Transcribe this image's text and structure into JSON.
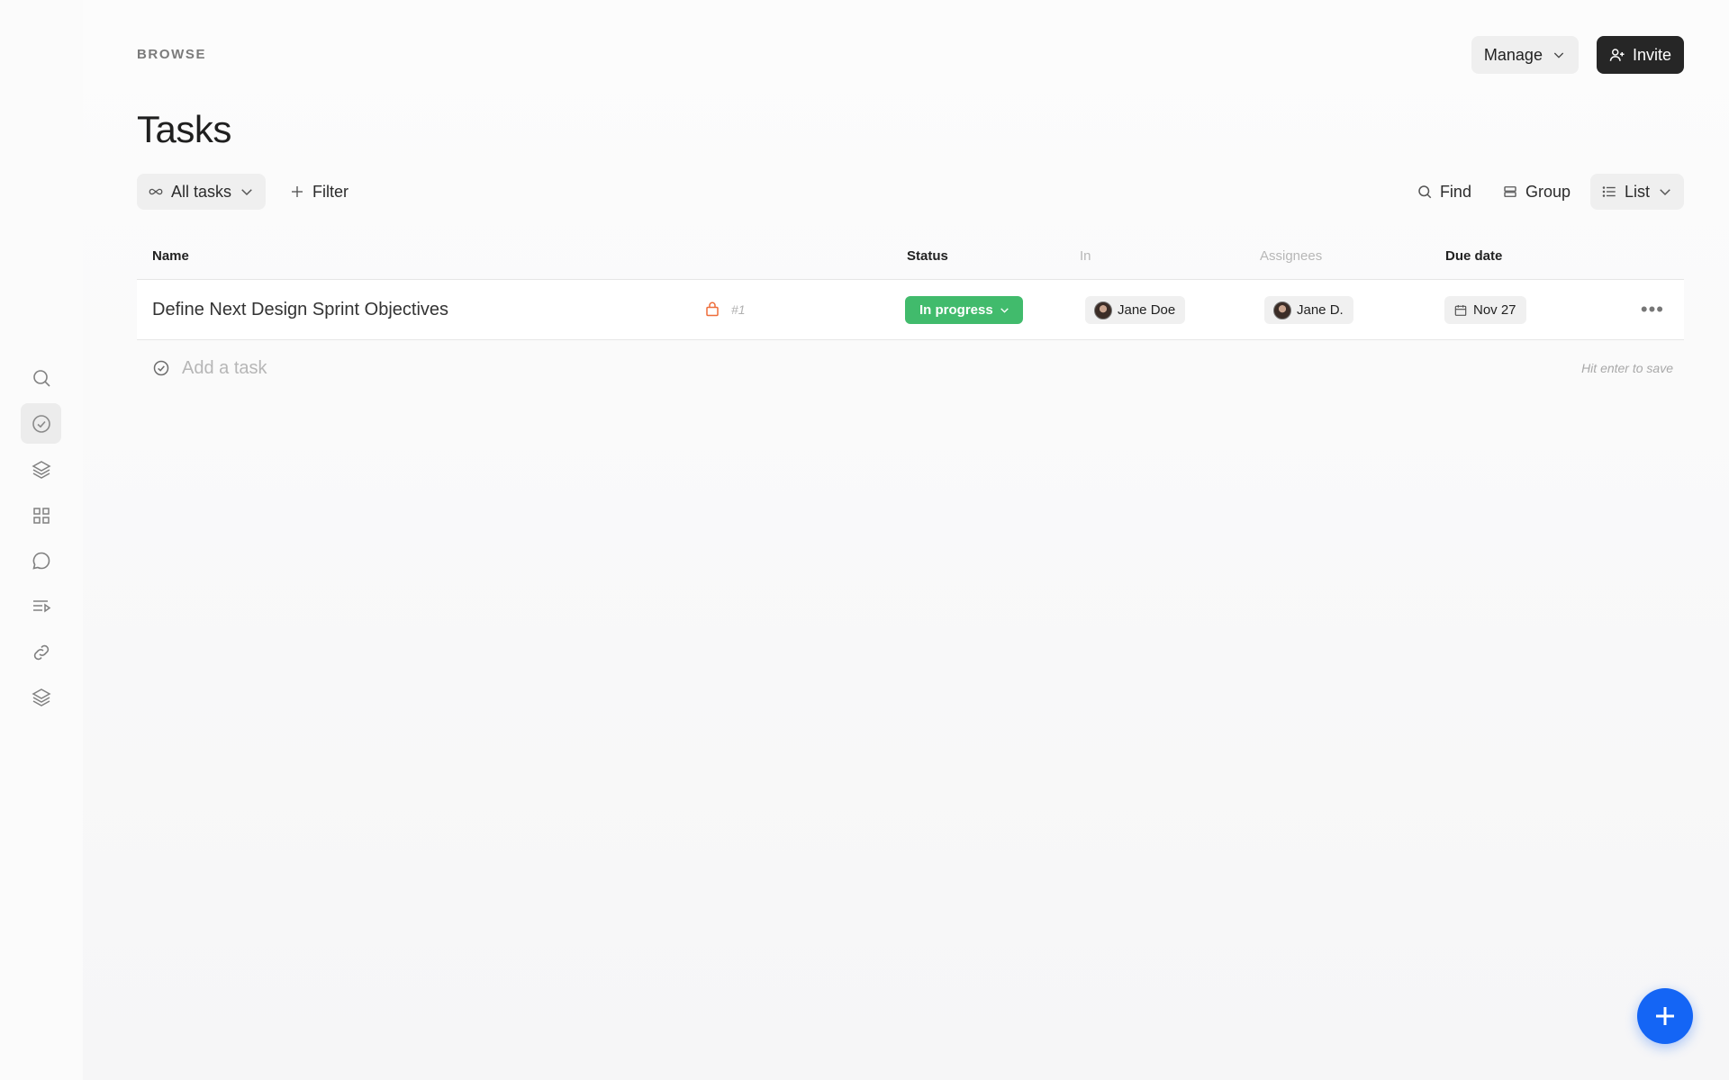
{
  "sidebar": {
    "items": [
      {
        "name": "search",
        "icon": "search-icon"
      },
      {
        "name": "tasks",
        "icon": "check-circle-icon",
        "active": true
      },
      {
        "name": "layers",
        "icon": "layers-icon"
      },
      {
        "name": "apps",
        "icon": "grid-icon"
      },
      {
        "name": "messages",
        "icon": "chat-bubble-icon"
      },
      {
        "name": "playlist",
        "icon": "list-play-icon"
      },
      {
        "name": "links",
        "icon": "link-icon"
      },
      {
        "name": "stack",
        "icon": "layers-icon"
      }
    ]
  },
  "header": {
    "breadcrumb": "BROWSE",
    "title": "Tasks",
    "manage_label": "Manage",
    "invite_label": "Invite"
  },
  "toolbar": {
    "view_label": "All tasks",
    "filter_label": "Filter",
    "find_label": "Find",
    "group_label": "Group",
    "layout_label": "List"
  },
  "table": {
    "columns": {
      "name": "Name",
      "status": "Status",
      "in": "In",
      "assignees": "Assignees",
      "due": "Due date"
    },
    "rows": [
      {
        "name": "Define Next Design Sprint Objectives",
        "number": "#1",
        "status": "In progress",
        "in": "Jane Doe",
        "assignee": "Jane D.",
        "due": "Nov 27"
      }
    ],
    "add_placeholder": "Add a task",
    "add_hint": "Hit enter to save"
  },
  "colors": {
    "status_in_progress": "#41bb6c",
    "fab": "#1465f5",
    "lock": "#ee6d3a",
    "invite_bg": "#262626"
  }
}
